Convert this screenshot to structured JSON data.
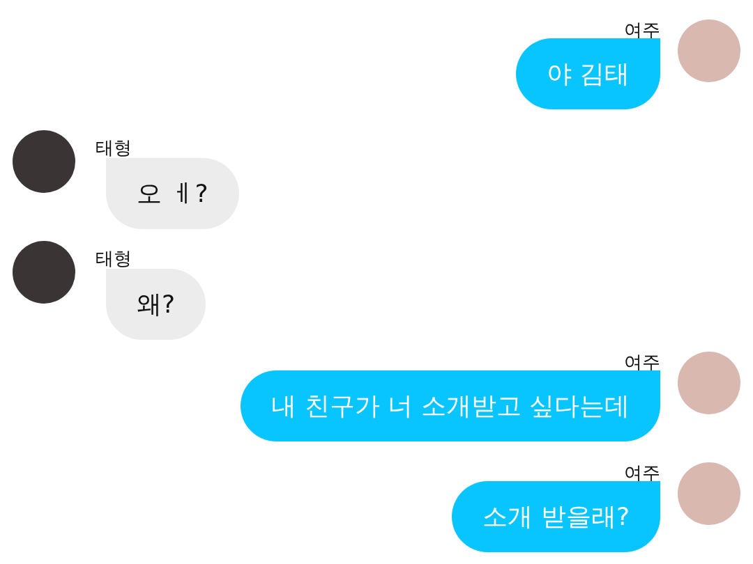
{
  "messages": [
    {
      "kind": "sent",
      "name": "여주",
      "text": "야 김태"
    },
    {
      "kind": "received",
      "name": "태형",
      "text": "오 ㅔ?"
    },
    {
      "kind": "received",
      "name": "태형",
      "text": "왜?"
    },
    {
      "kind": "sent",
      "name": "여주",
      "text": "내 친구가 너 소개받고 싶다는데"
    },
    {
      "kind": "sent",
      "name": "여주",
      "text": "소개 받을래?"
    }
  ]
}
